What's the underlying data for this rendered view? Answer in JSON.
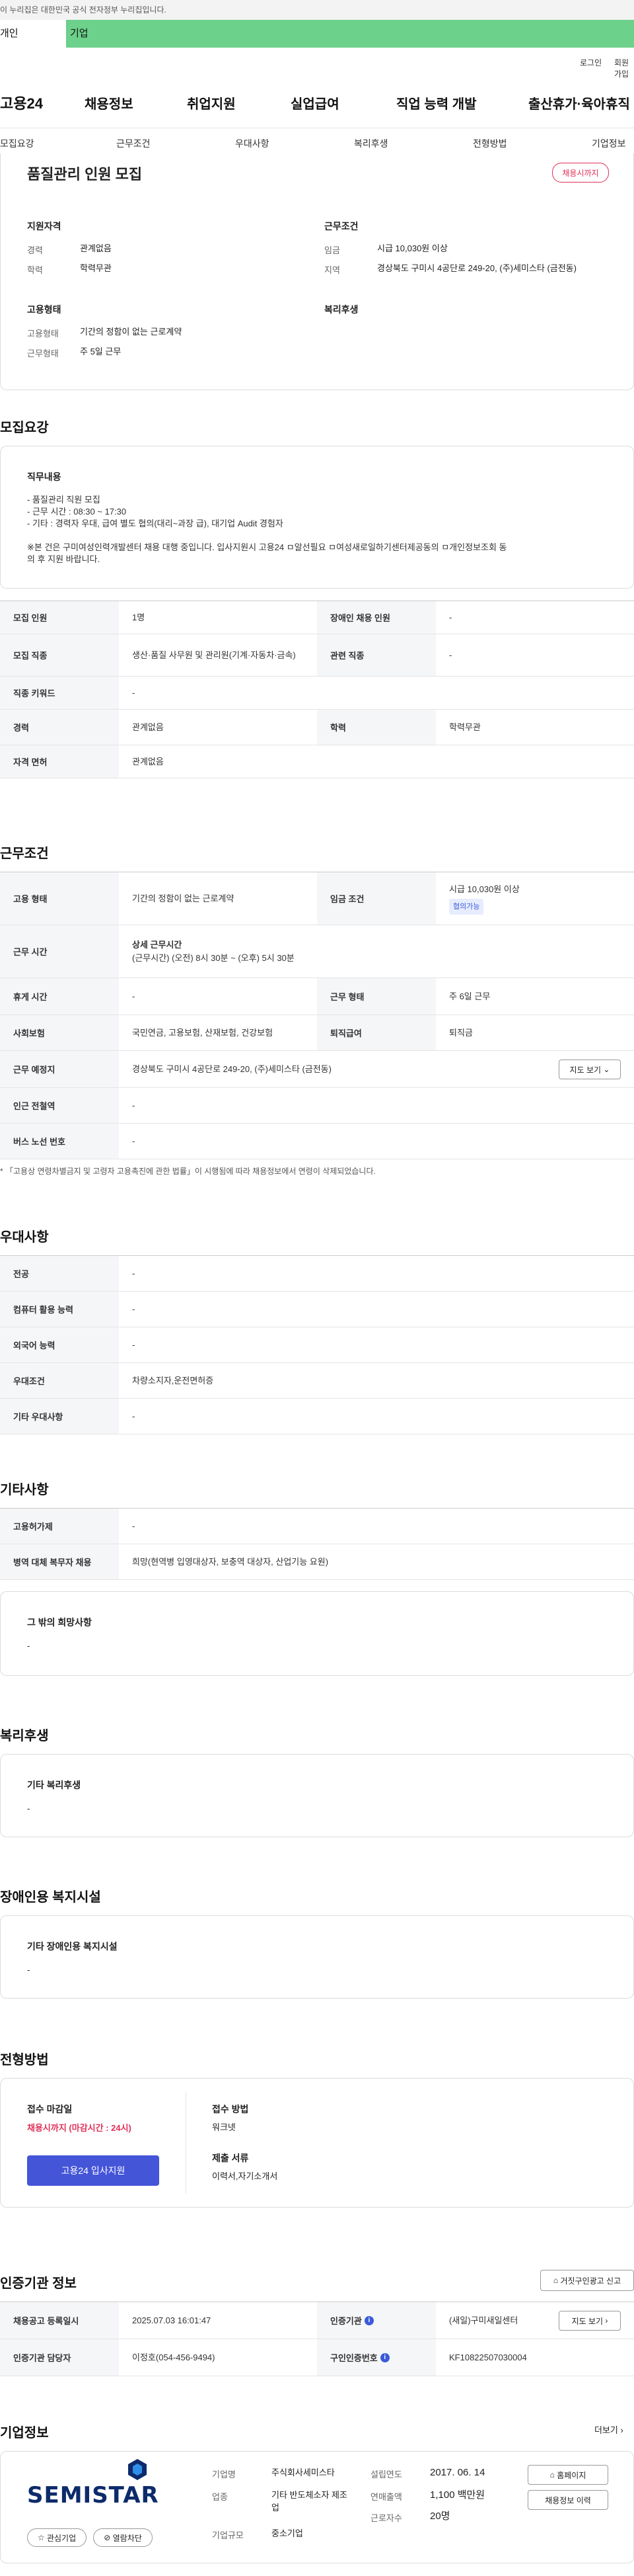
{
  "gov_banner": "이 누리집은 대한민국 공식 전자정부 누리집입니다.",
  "top_tabs": [
    "개인",
    "기업"
  ],
  "utility": [
    "로그인",
    "회원가입"
  ],
  "logo": "고용24",
  "gnb": [
    "채용정보",
    "취업지원",
    "실업급여",
    "직업 능력 개발",
    "출산휴가·육아휴직"
  ],
  "subnav": [
    "모집요강",
    "근무조건",
    "우대사항",
    "복리후생",
    "전형방법",
    "기업정보"
  ],
  "summary": {
    "title": "품질관리 인원 모집",
    "badge": "채용시까지",
    "applicant_head": "지원자격",
    "career_label": "경력",
    "career_value": "관계없음",
    "edu_label": "학력",
    "edu_value": "학력무관",
    "cond_head": "근무조건",
    "wage_label": "임금",
    "wage_value": "시급 10,030원 이상",
    "region_label": "지역",
    "region_value": "경상북도 구미시 4공단로 249-20, (주)세미스타 (금전동)",
    "emp_head": "고용형태",
    "emptype_label": "고용형태",
    "emptype_value": "기간의 정함이 없는 근로계약",
    "worktype_label": "근무형태",
    "worktype_value": "주 5일 근무",
    "welfare_head": "복리후생"
  },
  "recruit": {
    "section": "모집요강",
    "duty_head": "직무내용",
    "duty_lines": [
      "- 품질관리 직원 모집",
      "- 근무 시간 : 08:30 ~ 17:30",
      "- 기타 : 경력자 우대, 급여 별도 협의(대리~과장 급), 대기업 Audit 경험자",
      "",
      "※본 건은 구미여성인력개발센터 채용 대행 중입니다. 입사지원시 고용24 ㅁ알선필요 ㅁ여성새로일하기센터제공동의 ㅁ개인정보조회 동",
      "의 후 지원 바랍니다."
    ],
    "rows": [
      {
        "k1": "모집 인원",
        "v1": "1명",
        "k2": "장애인 채용 인원",
        "v2": "-"
      },
      {
        "k1": "모집 직종",
        "v1": "생산·품질 사무원 및 관리원(기계·자동차·금속)",
        "k2": "관련 직종",
        "v2": "-"
      },
      {
        "k1": "직종 키워드",
        "v1": "-"
      },
      {
        "k1": "경력",
        "v1": "관계없음",
        "k2": "학력",
        "v2": "학력무관"
      },
      {
        "k1": "자격 면허",
        "v1": "관계없음"
      }
    ]
  },
  "work": {
    "section": "근무조건",
    "emp_k": "고용 형태",
    "emp_v": "기간의 정함이 없는 근로계약",
    "wage_k": "임금 조건",
    "wage_v": "시급 10,030원 이상",
    "wage_badge": "협의가능",
    "time_k": "근무 시간",
    "time_head": "상세 근무시간",
    "time_v": "(근무시간) (오전) 8시 30분 ~ (오후) 5시 30분",
    "rest_k": "휴게 시간",
    "rest_v": "-",
    "type_k": "근무 형태",
    "type_v": "주 6일 근무",
    "ins_k": "사회보험",
    "ins_v": "국민연금, 고용보험, 산재보험, 건강보험",
    "ret_k": "퇴직급여",
    "ret_v": "퇴직금",
    "place_k": "근무 예정지",
    "place_v": "경상북도 구미시 4공단로 249-20, (주)세미스타 (금전동)",
    "map_btn": "지도 보기",
    "subway_k": "인근 전철역",
    "subway_v": "-",
    "bus_k": "버스 노선 번호",
    "bus_v": "-",
    "note": "* 「고용상 연령차별금지 및 고령자 고용촉진에 관한 법률」이 시행됨에 따라 채용정보에서 연령이 삭제되었습니다."
  },
  "pref": {
    "section": "우대사항",
    "rows": [
      {
        "k": "전공",
        "v": "-"
      },
      {
        "k": "컴퓨터 활용 능력",
        "v": "-"
      },
      {
        "k": "외국어 능력",
        "v": "-"
      },
      {
        "k": "우대조건",
        "v": "차량소지자,운전면허증"
      },
      {
        "k": "기타 우대사항",
        "v": "-"
      }
    ]
  },
  "etc": {
    "section": "기타사항",
    "rows": [
      {
        "k": "고용허가제",
        "v": "-"
      },
      {
        "k": "병역 대체 복무자 채용",
        "v": "희망(현역병 입영대상자, 보충역 대상자, 산업기능 요원)"
      }
    ],
    "other_head": "그 밖의 희망사항",
    "other_v": "-"
  },
  "welfare": {
    "section": "복리후생",
    "head": "기타 복리후생",
    "v": "-"
  },
  "disabled": {
    "section": "장애인용 복지시설",
    "head": "기타 장애인용 복지시설",
    "v": "-"
  },
  "selection": {
    "section": "전형방법",
    "deadline_head": "접수 마감일",
    "deadline_v": "채용시까지 (마감시간 : 24시)",
    "apply_btn": "고용24 입사지원",
    "method_head": "접수 방법",
    "method_v": "워크넷",
    "docs_head": "제출 서류",
    "docs_v": "이력서,자기소개서"
  },
  "cert": {
    "section": "인증기관 정보",
    "report_btn": "거짓구인광고 신고",
    "reg_k": "채용공고 등록일시",
    "reg_v": "2025.07.03 16:01:47",
    "org_k": "인증기관",
    "org_v": "(새일)구미새일센터",
    "map_btn": "지도 보기",
    "mgr_k": "인증기관 담당자",
    "mgr_v": "이정호(054-456-9494)",
    "no_k": "구인인증번호",
    "no_v": "KF10822507030004"
  },
  "company": {
    "section": "기업정보",
    "more": "더보기",
    "logo": "SEMISTAR",
    "fav_btn": "관심기업",
    "block_btn": "열람차단",
    "name_k": "기업명",
    "name_v": "주식회사세미스타",
    "ind_k": "업종",
    "ind_v": "기타 반도체소자 제조업",
    "size_k": "기업규모",
    "size_v": "중소기업",
    "est_k": "설립연도",
    "est_v": "2017. 06. 14",
    "sales_k": "연매출액",
    "sales_v": "1,100 백만원",
    "emp_k": "근로자수",
    "emp_v": "20명",
    "home_btn": "홈페이지",
    "history_btn": "채용정보 이력"
  }
}
